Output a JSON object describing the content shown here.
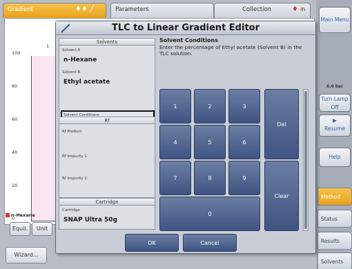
{
  "app": {
    "tabs": [
      {
        "label": "Gradient",
        "glyph": "♦♦ ╱"
      },
      {
        "label": "Parameters"
      },
      {
        "label": "Collection",
        "glyph": "♦ ⫙"
      }
    ],
    "graph": {
      "y_ticks": [
        "100",
        "80",
        "60",
        "40",
        "20",
        "0"
      ],
      "axis_mark": "1",
      "legend": "n-Hexane"
    },
    "buttons": {
      "equil": "Equil.",
      "unit": "Unit",
      "wizard": "Wizard..."
    },
    "side": {
      "main_menu": "Main Menu",
      "pressure": "6.6 bar",
      "turn_lamp_off": "Turn Lamp Off",
      "resume_icon": "▶",
      "resume": "Resume",
      "help": "Help",
      "tabs": [
        "Method",
        "Status",
        "Results",
        "Solvents"
      ]
    }
  },
  "dialog": {
    "title": "TLC to Linear Gradient Editor",
    "solvents": {
      "title": "Solvents",
      "a_label": "Solvent A",
      "a_value": "n-Hexane",
      "b_label": "Solvent B",
      "b_value": "Ethyl acetate",
      "conditions_label": "Solvent Conditions",
      "conditions_value": "–"
    },
    "rf": {
      "title": "Rf",
      "product": "Rf Product",
      "impurity1": "Rf Impurity 1",
      "impurity2": "Rf Impurity 2"
    },
    "cartridge": {
      "title": "Cartridge",
      "label": "Cartridge",
      "value": "SNAP Ultra 50g"
    },
    "description": {
      "title": "Solvent Conditions",
      "text": "Enter the percentage of Ethyl acetate (Solvent B) in the TLC solution."
    },
    "keypad": {
      "k1": "1",
      "k2": "2",
      "k3": "3",
      "k4": "4",
      "k5": "5",
      "k6": "6",
      "k7": "7",
      "k8": "8",
      "k9": "9",
      "k0": "0",
      "del": "Del",
      "clear": "Clear"
    },
    "ok": "OK",
    "cancel": "Cancel"
  },
  "colors": {
    "accent_orange": "#e9a21a",
    "key_blue": "#4d6190",
    "panel_gray": "#c9ced6"
  }
}
